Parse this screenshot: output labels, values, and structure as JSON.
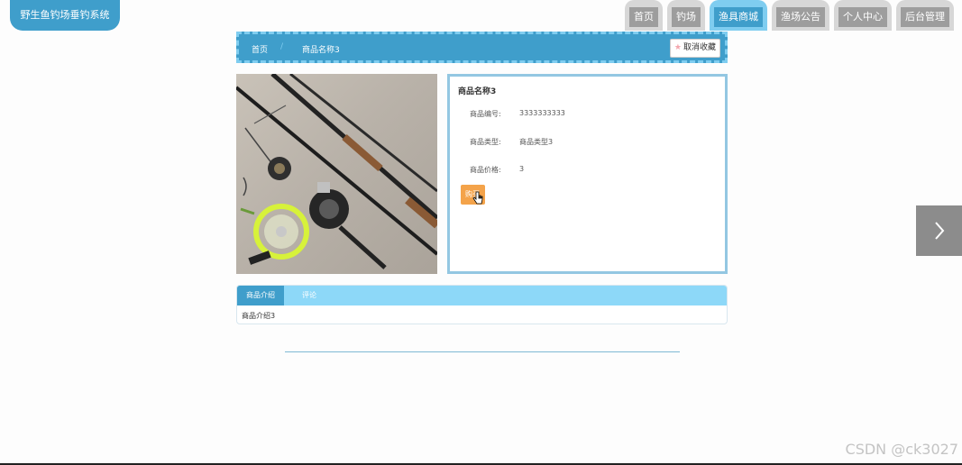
{
  "app": {
    "title": "野生鱼钓场垂钓系统"
  },
  "nav": {
    "items": [
      {
        "label": "首页"
      },
      {
        "label": "钓场"
      },
      {
        "label": "渔具商城",
        "active": true
      },
      {
        "label": "渔场公告"
      },
      {
        "label": "个人中心"
      },
      {
        "label": "后台管理"
      }
    ]
  },
  "breadcrumb": {
    "home": "首页",
    "separator": "/",
    "current": "商品名称3"
  },
  "favorite": {
    "label": "取消收藏",
    "icon": "star-icon"
  },
  "product": {
    "title": "商品名称3",
    "fields": [
      {
        "label": "商品编号:",
        "value": "3333333333"
      },
      {
        "label": "商品类型:",
        "value": "商品类型3"
      },
      {
        "label": "商品价格:",
        "value": "3"
      }
    ],
    "buy_label": "购买"
  },
  "tabs": [
    {
      "label": "商品介绍"
    },
    {
      "label": "评论"
    }
  ],
  "tab_content": "商品介绍3",
  "watermark": "CSDN @ck3027",
  "colors": {
    "primary": "#3f9ecb",
    "light": "#8dd8f8",
    "accent": "#f4a34a",
    "nav_inactive": "#9d9d9d"
  }
}
